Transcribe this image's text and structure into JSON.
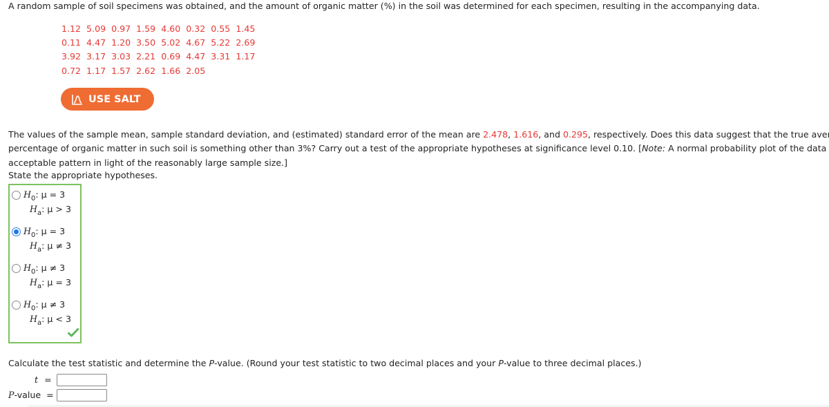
{
  "intro": "A random sample of soil specimens was obtained, and the amount of organic matter (%) in the soil was determined for each specimen, resulting in the accompanying data.",
  "data_rows": [
    [
      "1.12",
      "5.09",
      "0.97",
      "1.59",
      "4.60",
      "0.32",
      "0.55",
      "1.45"
    ],
    [
      "0.11",
      "4.47",
      "1.20",
      "3.50",
      "5.02",
      "4.67",
      "5.22",
      "2.69"
    ],
    [
      "3.92",
      "3.17",
      "3.03",
      "2.21",
      "0.69",
      "4.47",
      "3.31",
      "1.17"
    ],
    [
      "0.72",
      "1.17",
      "1.57",
      "2.62",
      "1.66",
      "2.05"
    ]
  ],
  "salt_button": {
    "label": "USE SALT",
    "icon": "distribution-curve-icon",
    "color": "#ef6c33"
  },
  "stats_paragraph": {
    "part1": "The values of the sample mean, sample standard deviation, and (estimated) standard error of the mean are ",
    "mean": "2.478",
    "sep1": ", ",
    "sd": "1.616",
    "sep2": ", and ",
    "se": "0.295",
    "part2": ", respectively. Does this data suggest that the true average",
    "line2a": "percentage of organic matter in such soil is something other than 3%? Carry out a test of the appropriate hypotheses at significance level 0.10. [",
    "note_label": "Note:",
    "line2b": " A normal probability plot of the data shows an",
    "line3": "acceptable pattern in light of the reasonably large sample size.]"
  },
  "hypotheses": {
    "prompt": "State the appropriate hypotheses.",
    "null_symbol": "H",
    "null_sub": "0",
    "alt_symbol": "H",
    "alt_sub": "a",
    "options": [
      {
        "h0": ": μ = 3",
        "ha": ": μ > 3",
        "selected": false
      },
      {
        "h0": ": μ = 3",
        "ha": ": μ ≠ 3",
        "selected": true
      },
      {
        "h0": ": μ ≠ 3",
        "ha": ": μ = 3",
        "selected": false
      },
      {
        "h0": ": μ ≠ 3",
        "ha": ": μ < 3",
        "selected": false
      }
    ],
    "status": "correct",
    "status_icon": "checkmark-icon",
    "box_color": "#7cc15d"
  },
  "calculate": {
    "prompt_a": "Calculate the test statistic and determine the ",
    "p_italic": "P",
    "prompt_b": "-value. (Round your test statistic to two decimal places and your ",
    "p_italic2": "P",
    "prompt_c": "-value to three decimal places.)",
    "t_label": "t",
    "eq": "=",
    "p_label_italic": "P",
    "p_label_rest": "-value",
    "t_value": "",
    "p_value": ""
  },
  "colors": {
    "highlight": "#e53935",
    "text": "#222222",
    "radio_selected": "#1976f2"
  }
}
